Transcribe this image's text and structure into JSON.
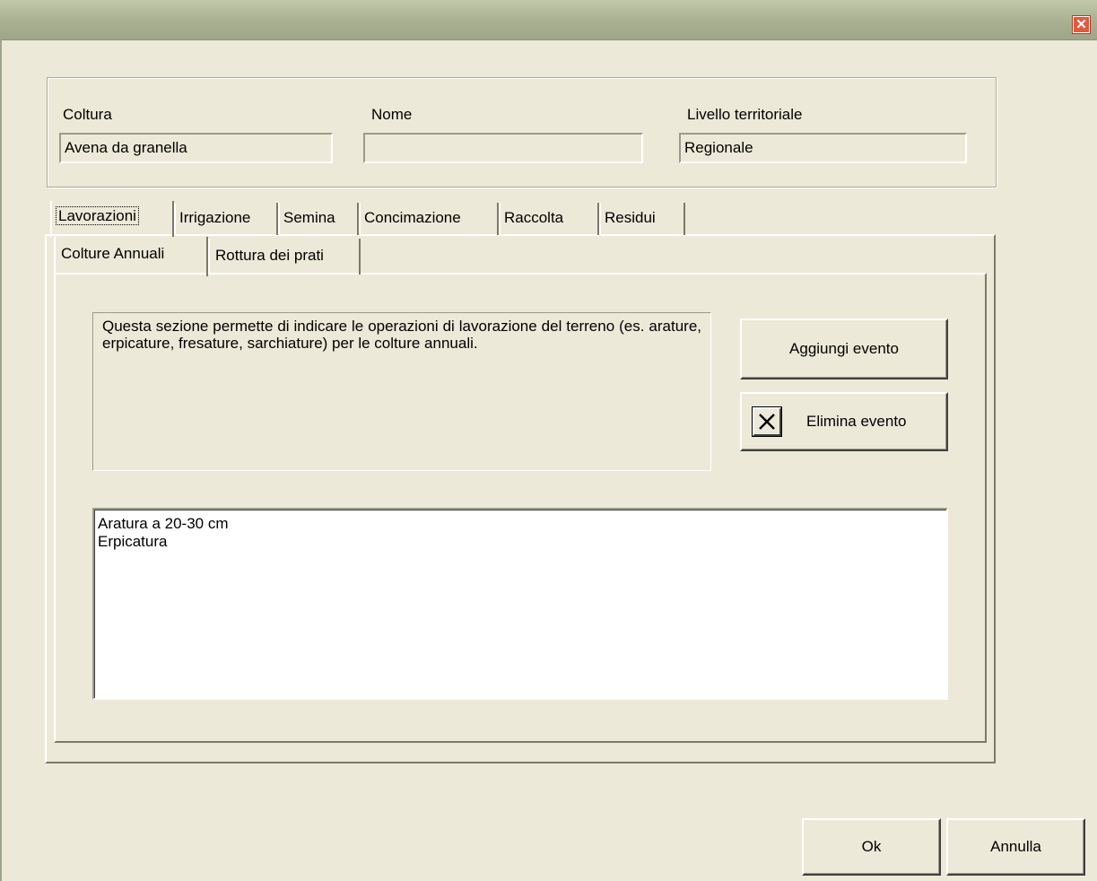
{
  "window": {
    "close_icon": "close-icon",
    "close_color": "#e2593d"
  },
  "header": {
    "coltura_label": "Coltura",
    "coltura_value": "Avena da granella",
    "nome_label": "Nome",
    "nome_value": "",
    "livello_label": "Livello territoriale",
    "livello_value": "Regionale"
  },
  "tabs": [
    {
      "label": "Lavorazioni",
      "active": true
    },
    {
      "label": "Irrigazione"
    },
    {
      "label": "Semina"
    },
    {
      "label": "Concimazione"
    },
    {
      "label": "Raccolta"
    },
    {
      "label": "Residui"
    }
  ],
  "subtabs": [
    {
      "label": "Colture Annuali",
      "active": true
    },
    {
      "label": "Rottura dei prati"
    }
  ],
  "description": "Questa sezione permette di indicare le operazioni di lavorazione del terreno (es. arature, erpicature, fresature, sarchiature) per le colture annuali.",
  "buttons": {
    "add": "Aggiungi evento",
    "delete": "Elimina evento",
    "delete_icon": "x-icon",
    "ok": "Ok",
    "cancel": "Annulla"
  },
  "events": [
    "Aratura a 20-30 cm",
    "Erpicatura"
  ]
}
